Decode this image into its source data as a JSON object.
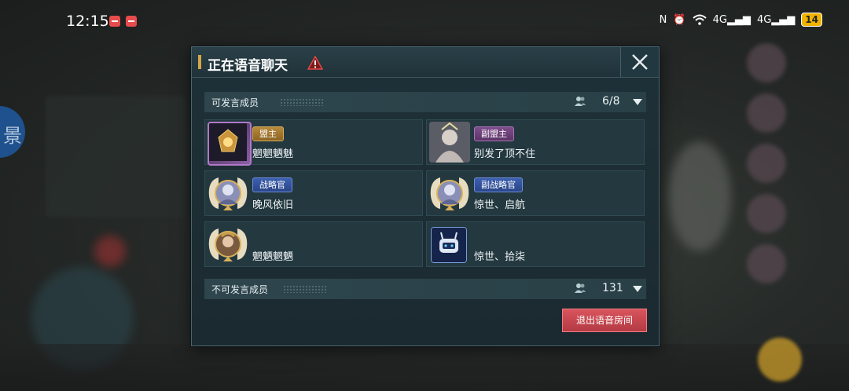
{
  "status_bar": {
    "time": "12:15",
    "battery": "14",
    "network_1": "4G",
    "network_2": "4G"
  },
  "side_tab": {
    "glyph": "景"
  },
  "dialog": {
    "title": "正在语音聊天",
    "speakers_section": {
      "label": "可发言成员",
      "count": "6/8"
    },
    "members": [
      {
        "role": "盟主",
        "role_color": "gold",
        "name": "魍魍魉魅"
      },
      {
        "role": "副盟主",
        "role_color": "purple",
        "name": "别发了顶不住"
      },
      {
        "role": "战略官",
        "role_color": "blue",
        "name": "晚风依旧"
      },
      {
        "role": "副战略官",
        "role_color": "blue",
        "name": "惊世、启航"
      },
      {
        "role": "",
        "role_color": "",
        "name": "魍魉魍魉"
      },
      {
        "role": "",
        "role_color": "",
        "name": "惊世、拾柒"
      }
    ],
    "listeners_section": {
      "label": "不可发言成员",
      "count": "131"
    },
    "exit_button": "退出语音房间"
  },
  "colors": {
    "dialog_bg": "#1f3138",
    "accent_gold": "#d4a64a",
    "exit_red": "#c9464e"
  }
}
